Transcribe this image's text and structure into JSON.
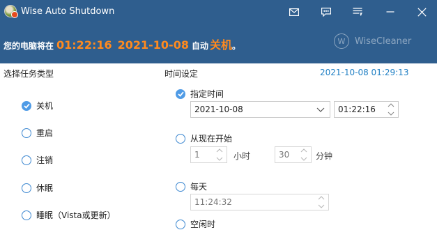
{
  "app": {
    "title": "Wise Auto Shutdown"
  },
  "banner": {
    "prefix": "您的电脑将在",
    "time": "01:22:16",
    "date": "2021-10-08",
    "auto": "自动",
    "action": "关机",
    "suffix": "。"
  },
  "logo": {
    "mark": "W",
    "text": "WiseCleaner"
  },
  "task_panel": {
    "title": "选择任务类型",
    "tasks": [
      {
        "label": "关机",
        "checked": true
      },
      {
        "label": "重启",
        "checked": false
      },
      {
        "label": "注销",
        "checked": false
      },
      {
        "label": "休眠",
        "checked": false
      },
      {
        "label": "睡眠（Vista或更新）",
        "checked": false
      }
    ]
  },
  "time_panel": {
    "title": "时间设定",
    "current_time": "2021-10-08 01:29:13",
    "specified": {
      "label": "指定时间",
      "checked": true,
      "date": "2021-10-08",
      "time": "01:22:16"
    },
    "from_now": {
      "label": "从现在开始",
      "checked": false,
      "hours": "1",
      "hours_unit": "小时",
      "minutes": "30",
      "minutes_unit": "分钟"
    },
    "daily": {
      "label": "每天",
      "checked": false,
      "time": "11:24:32"
    },
    "idle": {
      "label": "空闲时",
      "checked": false
    }
  },
  "colors": {
    "header_bg": "#2f5e8e",
    "accent_orange": "#ff8a1e",
    "link_blue": "#1f7fc4",
    "radio_blue": "#4f9be6"
  },
  "icons": [
    "app-logo-icon",
    "mail-icon",
    "feedback-icon",
    "menu-icon",
    "minimize-icon",
    "close-icon",
    "check-icon",
    "chevron-down-icon",
    "spin-up-icon",
    "spin-down-icon"
  ]
}
